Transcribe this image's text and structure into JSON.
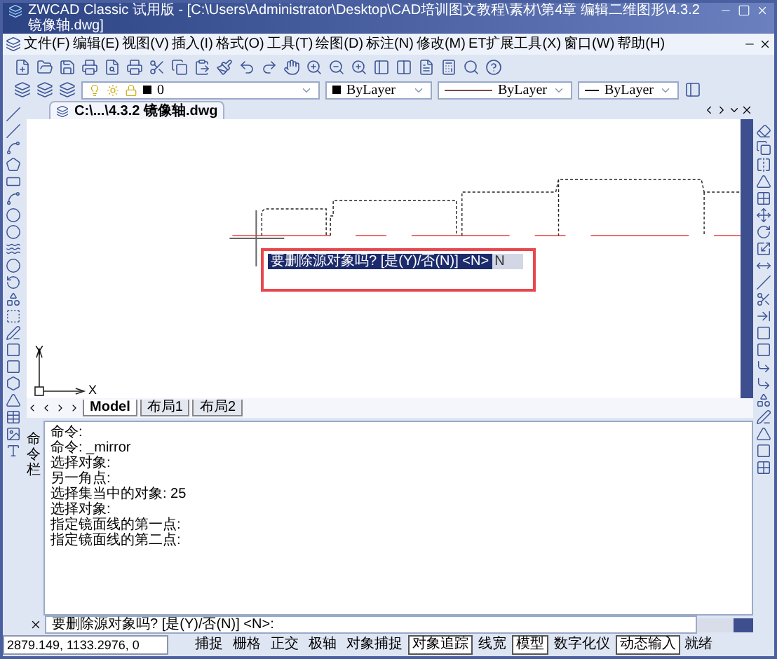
{
  "window": {
    "title": "ZWCAD Classic 试用版 - [C:\\Users\\Administrator\\Desktop\\CAD培训图文教程\\素材\\第4章 编辑二维图形\\4.3.2 镜像轴.dwg]"
  },
  "menu": [
    "文件(F)",
    "编辑(E)",
    "视图(V)",
    "插入(I)",
    "格式(O)",
    "工具(T)",
    "绘图(D)",
    "标注(N)",
    "修改(M)",
    "ET扩展工具(X)",
    "窗口(W)",
    "帮助(H)"
  ],
  "properties_toolbar": {
    "layer": "0",
    "color_setting": "ByLayer",
    "linetype": "ByLayer",
    "lineweight": "ByLayer"
  },
  "document_tab": {
    "title": "C:\\...\\4.3.2 镜像轴.dwg"
  },
  "drawing": {
    "ucs_x": "X",
    "ucs_y": "Y",
    "prompt": {
      "text": "要删除源对象吗? [是(Y)/否(N)] <N>",
      "value": "N"
    }
  },
  "layout_tabs": [
    {
      "label": "Model",
      "selected": true
    },
    {
      "label": "布局1",
      "selected": false
    },
    {
      "label": "布局2",
      "selected": false
    }
  ],
  "command_window": {
    "label": "命令栏",
    "history": [
      "命令:",
      "命令: _mirror",
      "选择对象:",
      "另一角点:",
      "选择集当中的对象: 25",
      "选择对象:",
      "指定镜面线的第一点:",
      "指定镜面线的第二点:"
    ],
    "prompt": "要删除源对象吗? [是(Y)/否(N)] <N>:"
  },
  "status_bar": {
    "coordinates": "2879.149, 1133.2976, 0",
    "toggles": [
      {
        "label": "捕捉",
        "on": false
      },
      {
        "label": "栅格",
        "on": false
      },
      {
        "label": "正交",
        "on": false
      },
      {
        "label": "极轴",
        "on": false
      },
      {
        "label": "对象捕捉",
        "on": false
      },
      {
        "label": "对象追踪",
        "on": true
      },
      {
        "label": "线宽",
        "on": false
      },
      {
        "label": "模型",
        "on": true
      },
      {
        "label": "数字化仪",
        "on": false
      },
      {
        "label": "动态输入",
        "on": true
      }
    ],
    "state": "就绪"
  }
}
